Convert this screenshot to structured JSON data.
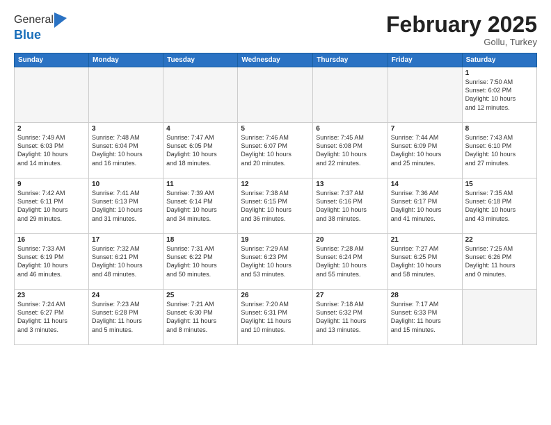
{
  "logo": {
    "general": "General",
    "blue": "Blue"
  },
  "title": "February 2025",
  "location": "Gollu, Turkey",
  "weekdays": [
    "Sunday",
    "Monday",
    "Tuesday",
    "Wednesday",
    "Thursday",
    "Friday",
    "Saturday"
  ],
  "weeks": [
    [
      {
        "day": "",
        "info": ""
      },
      {
        "day": "",
        "info": ""
      },
      {
        "day": "",
        "info": ""
      },
      {
        "day": "",
        "info": ""
      },
      {
        "day": "",
        "info": ""
      },
      {
        "day": "",
        "info": ""
      },
      {
        "day": "1",
        "info": "Sunrise: 7:50 AM\nSunset: 6:02 PM\nDaylight: 10 hours\nand 12 minutes."
      }
    ],
    [
      {
        "day": "2",
        "info": "Sunrise: 7:49 AM\nSunset: 6:03 PM\nDaylight: 10 hours\nand 14 minutes."
      },
      {
        "day": "3",
        "info": "Sunrise: 7:48 AM\nSunset: 6:04 PM\nDaylight: 10 hours\nand 16 minutes."
      },
      {
        "day": "4",
        "info": "Sunrise: 7:47 AM\nSunset: 6:05 PM\nDaylight: 10 hours\nand 18 minutes."
      },
      {
        "day": "5",
        "info": "Sunrise: 7:46 AM\nSunset: 6:07 PM\nDaylight: 10 hours\nand 20 minutes."
      },
      {
        "day": "6",
        "info": "Sunrise: 7:45 AM\nSunset: 6:08 PM\nDaylight: 10 hours\nand 22 minutes."
      },
      {
        "day": "7",
        "info": "Sunrise: 7:44 AM\nSunset: 6:09 PM\nDaylight: 10 hours\nand 25 minutes."
      },
      {
        "day": "8",
        "info": "Sunrise: 7:43 AM\nSunset: 6:10 PM\nDaylight: 10 hours\nand 27 minutes."
      }
    ],
    [
      {
        "day": "9",
        "info": "Sunrise: 7:42 AM\nSunset: 6:11 PM\nDaylight: 10 hours\nand 29 minutes."
      },
      {
        "day": "10",
        "info": "Sunrise: 7:41 AM\nSunset: 6:13 PM\nDaylight: 10 hours\nand 31 minutes."
      },
      {
        "day": "11",
        "info": "Sunrise: 7:39 AM\nSunset: 6:14 PM\nDaylight: 10 hours\nand 34 minutes."
      },
      {
        "day": "12",
        "info": "Sunrise: 7:38 AM\nSunset: 6:15 PM\nDaylight: 10 hours\nand 36 minutes."
      },
      {
        "day": "13",
        "info": "Sunrise: 7:37 AM\nSunset: 6:16 PM\nDaylight: 10 hours\nand 38 minutes."
      },
      {
        "day": "14",
        "info": "Sunrise: 7:36 AM\nSunset: 6:17 PM\nDaylight: 10 hours\nand 41 minutes."
      },
      {
        "day": "15",
        "info": "Sunrise: 7:35 AM\nSunset: 6:18 PM\nDaylight: 10 hours\nand 43 minutes."
      }
    ],
    [
      {
        "day": "16",
        "info": "Sunrise: 7:33 AM\nSunset: 6:19 PM\nDaylight: 10 hours\nand 46 minutes."
      },
      {
        "day": "17",
        "info": "Sunrise: 7:32 AM\nSunset: 6:21 PM\nDaylight: 10 hours\nand 48 minutes."
      },
      {
        "day": "18",
        "info": "Sunrise: 7:31 AM\nSunset: 6:22 PM\nDaylight: 10 hours\nand 50 minutes."
      },
      {
        "day": "19",
        "info": "Sunrise: 7:29 AM\nSunset: 6:23 PM\nDaylight: 10 hours\nand 53 minutes."
      },
      {
        "day": "20",
        "info": "Sunrise: 7:28 AM\nSunset: 6:24 PM\nDaylight: 10 hours\nand 55 minutes."
      },
      {
        "day": "21",
        "info": "Sunrise: 7:27 AM\nSunset: 6:25 PM\nDaylight: 10 hours\nand 58 minutes."
      },
      {
        "day": "22",
        "info": "Sunrise: 7:25 AM\nSunset: 6:26 PM\nDaylight: 11 hours\nand 0 minutes."
      }
    ],
    [
      {
        "day": "23",
        "info": "Sunrise: 7:24 AM\nSunset: 6:27 PM\nDaylight: 11 hours\nand 3 minutes."
      },
      {
        "day": "24",
        "info": "Sunrise: 7:23 AM\nSunset: 6:28 PM\nDaylight: 11 hours\nand 5 minutes."
      },
      {
        "day": "25",
        "info": "Sunrise: 7:21 AM\nSunset: 6:30 PM\nDaylight: 11 hours\nand 8 minutes."
      },
      {
        "day": "26",
        "info": "Sunrise: 7:20 AM\nSunset: 6:31 PM\nDaylight: 11 hours\nand 10 minutes."
      },
      {
        "day": "27",
        "info": "Sunrise: 7:18 AM\nSunset: 6:32 PM\nDaylight: 11 hours\nand 13 minutes."
      },
      {
        "day": "28",
        "info": "Sunrise: 7:17 AM\nSunset: 6:33 PM\nDaylight: 11 hours\nand 15 minutes."
      },
      {
        "day": "",
        "info": ""
      }
    ]
  ]
}
